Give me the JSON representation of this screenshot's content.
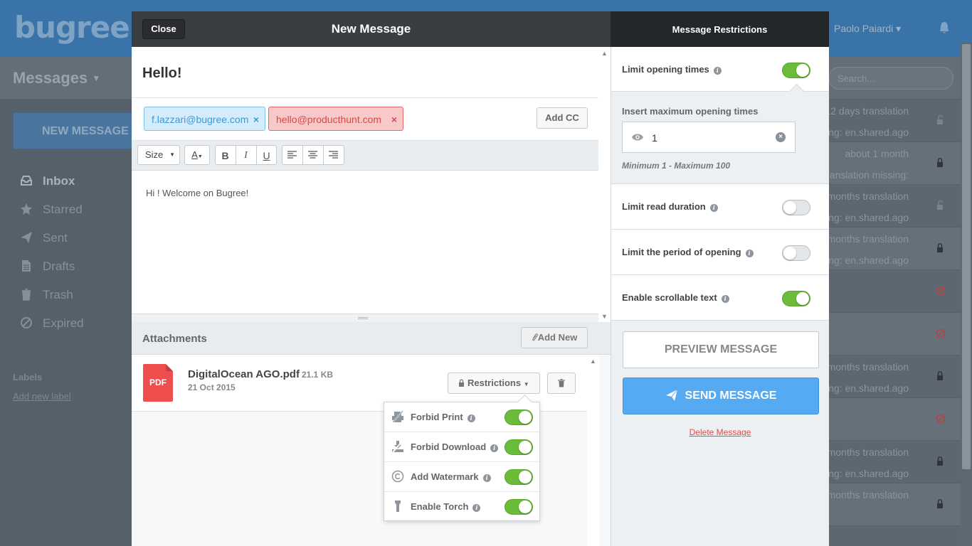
{
  "background": {
    "logo": "bugree",
    "user_name": "Paolo Paiardi",
    "section_title": "Messages",
    "search_placeholder": "Search...",
    "new_message_label": "NEW MESSAGE",
    "nav": [
      {
        "label": "Inbox",
        "icon": "inbox-icon",
        "active": true
      },
      {
        "label": "Starred",
        "icon": "star-icon",
        "active": false
      },
      {
        "label": "Sent",
        "icon": "send-icon",
        "active": false
      },
      {
        "label": "Drafts",
        "icon": "document-icon",
        "active": false
      },
      {
        "label": "Trash",
        "icon": "trash-icon",
        "active": false
      },
      {
        "label": "Expired",
        "icon": "ban-icon",
        "active": false
      }
    ],
    "labels_heading": "Labels",
    "add_label_link": "Add new label",
    "list_rows": [
      {
        "line1": "12 days translation",
        "line2": "ing: en.shared.ago",
        "icon": "lock-open-icon"
      },
      {
        "line1": "about 1 month",
        "line2": "ranslation missing:",
        "icon": "lock-icon"
      },
      {
        "line1": "months translation",
        "line2": "ing: en.shared.ago",
        "icon": "lock-open-icon"
      },
      {
        "line1": "months translation",
        "line2": "ing: en.shared.ago",
        "icon": "lock-icon"
      },
      {
        "line1": "",
        "line2": "",
        "icon": "ban-icon"
      },
      {
        "line1": "",
        "line2": "",
        "icon": "ban-icon"
      },
      {
        "line1": "months translation",
        "line2": "ing: en.shared.ago",
        "icon": "lock-icon"
      },
      {
        "line1": "",
        "line2": "",
        "icon": "ban-icon"
      },
      {
        "line1": "months translation",
        "line2": "ing: en.shared.ago",
        "icon": "lock-icon"
      },
      {
        "line1": "months translation",
        "line2": "",
        "icon": "lock-icon"
      }
    ]
  },
  "composer": {
    "close_label": "Close",
    "title": "New Message",
    "subject": "Hello!",
    "recipients": [
      {
        "email": "f.lazzari@bugree.com",
        "status": "valid",
        "remove": "×"
      },
      {
        "email": "hello@producthunt.com",
        "status": "invalid",
        "remove": "×"
      }
    ],
    "add_cc_label": "Add CC",
    "toolbar": {
      "size_label": "Size",
      "color_label": "A",
      "bold": "B",
      "italic": "I",
      "underline": "U"
    },
    "body_text": "Hi ! Welcome on Bugree!",
    "attachments_label": "Attachments",
    "add_new_label": "Add New",
    "file": {
      "name": "DigitalOcean AGO.pdf",
      "size": "21.1 KB",
      "date": "21 Oct 2015",
      "type_badge": "PDF"
    },
    "restrictions_label": "Restrictions",
    "file_restrictions": [
      {
        "label": "Forbid Print",
        "icon": "print-icon",
        "enabled": true
      },
      {
        "label": "Forbid Download",
        "icon": "download-icon",
        "enabled": true
      },
      {
        "label": "Add Watermark",
        "icon": "copyright-icon",
        "enabled": true
      },
      {
        "label": "Enable Torch",
        "icon": "flashlight-icon",
        "enabled": true
      }
    ]
  },
  "restrictions": {
    "title": "Message Restrictions",
    "limit_opening_times": {
      "label": "Limit opening times",
      "enabled": true
    },
    "max_opening": {
      "caption": "Insert maximum opening times",
      "value": "1",
      "hint": "Minimum 1 - Maximum 100"
    },
    "limit_read_duration": {
      "label": "Limit read duration",
      "enabled": false
    },
    "limit_period": {
      "label": "Limit the period of opening",
      "enabled": false
    },
    "scrollable_text": {
      "label": "Enable scrollable text",
      "enabled": true
    },
    "preview_label": "PREVIEW MESSAGE",
    "send_label": "SEND MESSAGE",
    "delete_label": "Delete Message"
  },
  "colors": {
    "accent_blue": "#55aaf2",
    "toggle_on": "#6cbc3b",
    "danger": "#e14b4b"
  }
}
